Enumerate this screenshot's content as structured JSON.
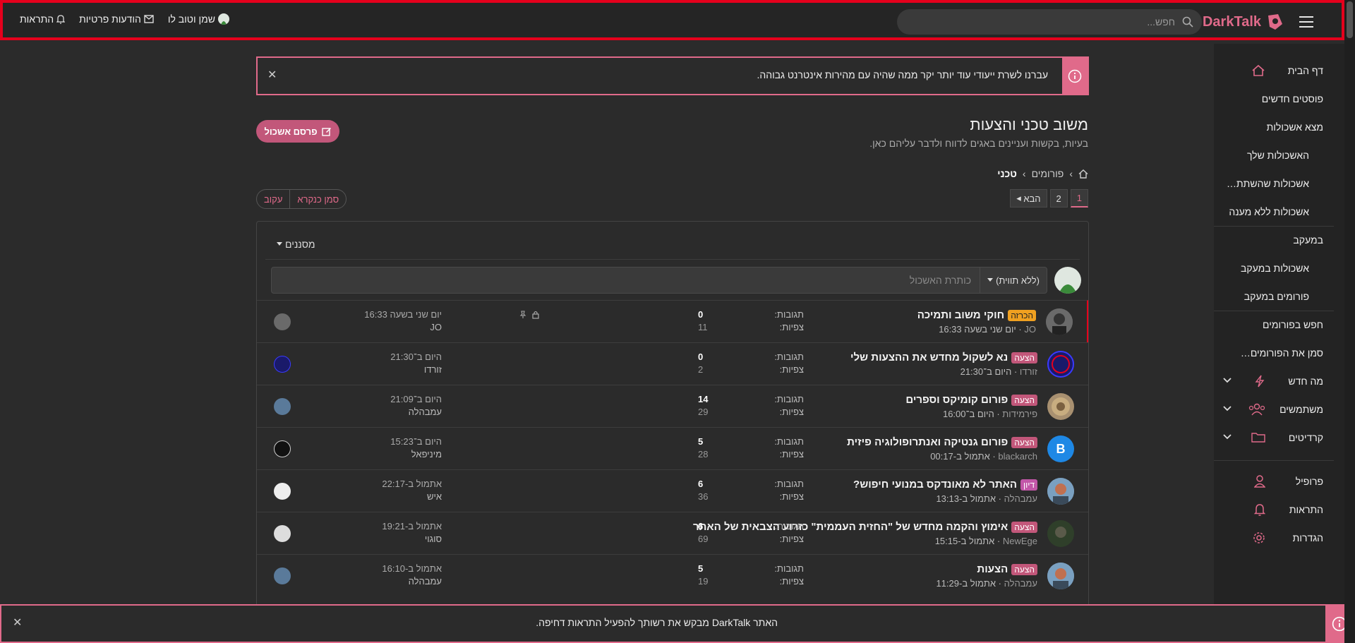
{
  "header": {
    "logo_text": "DarkTalk",
    "search_placeholder": "חפש...",
    "user_name": "שמן וטוב לו",
    "messages_label": "הודעות פרטיות",
    "alerts_label": "התראות"
  },
  "sidebar": {
    "items": [
      {
        "label": "דף הבית",
        "icon": "home-icon"
      },
      {
        "label": "פוסטים חדשים"
      },
      {
        "label": "מצא אשכולות"
      },
      {
        "label": "האשכולות שלך"
      },
      {
        "label": "אשכולות שהשתתפת בהם"
      },
      {
        "label": "אשכולות ללא מענה"
      },
      {
        "label": "במעקב"
      },
      {
        "label": "אשכולות במעקב"
      },
      {
        "label": "פורומים במעקב"
      },
      {
        "label": "חפש בפורומים"
      },
      {
        "label": "סמן את הפורומים כנקראו"
      },
      {
        "label": "מה חדש",
        "icon": "bolt-icon"
      },
      {
        "label": "משתמשים",
        "icon": "users-icon"
      },
      {
        "label": "קרדיטים",
        "icon": "folder-icon"
      },
      {
        "label": "פרופיל",
        "icon": "user-icon"
      },
      {
        "label": "התראות",
        "icon": "bell-icon"
      },
      {
        "label": "הגדרות",
        "icon": "gear-icon"
      }
    ]
  },
  "notice": {
    "text": "עברנו לשרת ייעודי עוד יותר יקר ממה שהיה עם מהירות אינטרנט גבוהה."
  },
  "forum": {
    "title": "משוב טכני והצעות",
    "description": "בעיות, בקשות ועניינים באגים לדווח ולדבר עליהם כאן.",
    "post_button": "פרסם אשכול",
    "breadcrumb": {
      "forums": "פורומים",
      "current": "טכני"
    },
    "pager": {
      "page1": "1",
      "page2": "2",
      "next": "הבא"
    },
    "mark_read": "סמן כנקרא",
    "follow": "עקוב",
    "filters": "מסננים",
    "new_thread": {
      "prefix": "(ללא תווית)",
      "placeholder": "כותרת האשכול"
    }
  },
  "stats_labels": {
    "replies": "תגובות:",
    "views": "צפיות:"
  },
  "threads": [
    {
      "badge": "הכרזה",
      "title": "חוקי משוב ותמיכה",
      "author": "JO",
      "date": "יום שני בשעה 16:33",
      "replies": "0",
      "views": "11",
      "last_date": "יום שני בשעה 16:33",
      "last_user": "JO"
    },
    {
      "badge": "הצעה",
      "title": "נא לשקול מחדש את ההצעות שלי",
      "author": "זורדו",
      "date": "היום ב־21:30",
      "replies": "0",
      "views": "2",
      "last_date": "היום ב־21:30",
      "last_user": "זורדו"
    },
    {
      "badge": "הצעה",
      "title": "פורום קומיקס וספרים",
      "author": "פירמידות",
      "date": "היום ב־16:00",
      "replies": "14",
      "views": "29",
      "last_date": "היום ב־21:09",
      "last_user": "עמבהלה"
    },
    {
      "badge": "הצעה",
      "title": "פורום גנטיקה ואנתרופולוגיה פיזית",
      "author": "blackarch",
      "date": "אתמול ב-00:17",
      "replies": "5",
      "views": "28",
      "last_date": "היום ב־15:23",
      "last_user": "מיניפאל"
    },
    {
      "badge": "דיון",
      "title": "האתר לא מאונדקס במנועי חיפוש?",
      "author": "עמבהלה",
      "date": "אתמול ב-13:13",
      "replies": "6",
      "views": "36",
      "last_date": "אתמול ב-22:17",
      "last_user": "איש"
    },
    {
      "badge": "הצעה",
      "title": "אימוץ והקמה מחדש של \"החזית העממית\" כזרוע הצבאית של האתר",
      "author": "NewEge",
      "date": "אתמול ב-15:15",
      "replies": "6",
      "views": "69",
      "last_date": "אתמול ב-19:21",
      "last_user": "סוגוי"
    },
    {
      "badge": "הצעה",
      "title": "הצעות",
      "author": "עמבהלה",
      "date": "אתמול ב-11:29",
      "replies": "5",
      "views": "19",
      "last_date": "אתמול ב-16:10",
      "last_user": "עמבהלה"
    }
  ],
  "bottom_notice": {
    "text": "האתר DarkTalk מבקש את רשותך להפעיל התראות דחיפה."
  },
  "colors": {
    "accent": "#e06a8a",
    "highlight_border": "#e5001c",
    "announcement": "#f0a020"
  }
}
